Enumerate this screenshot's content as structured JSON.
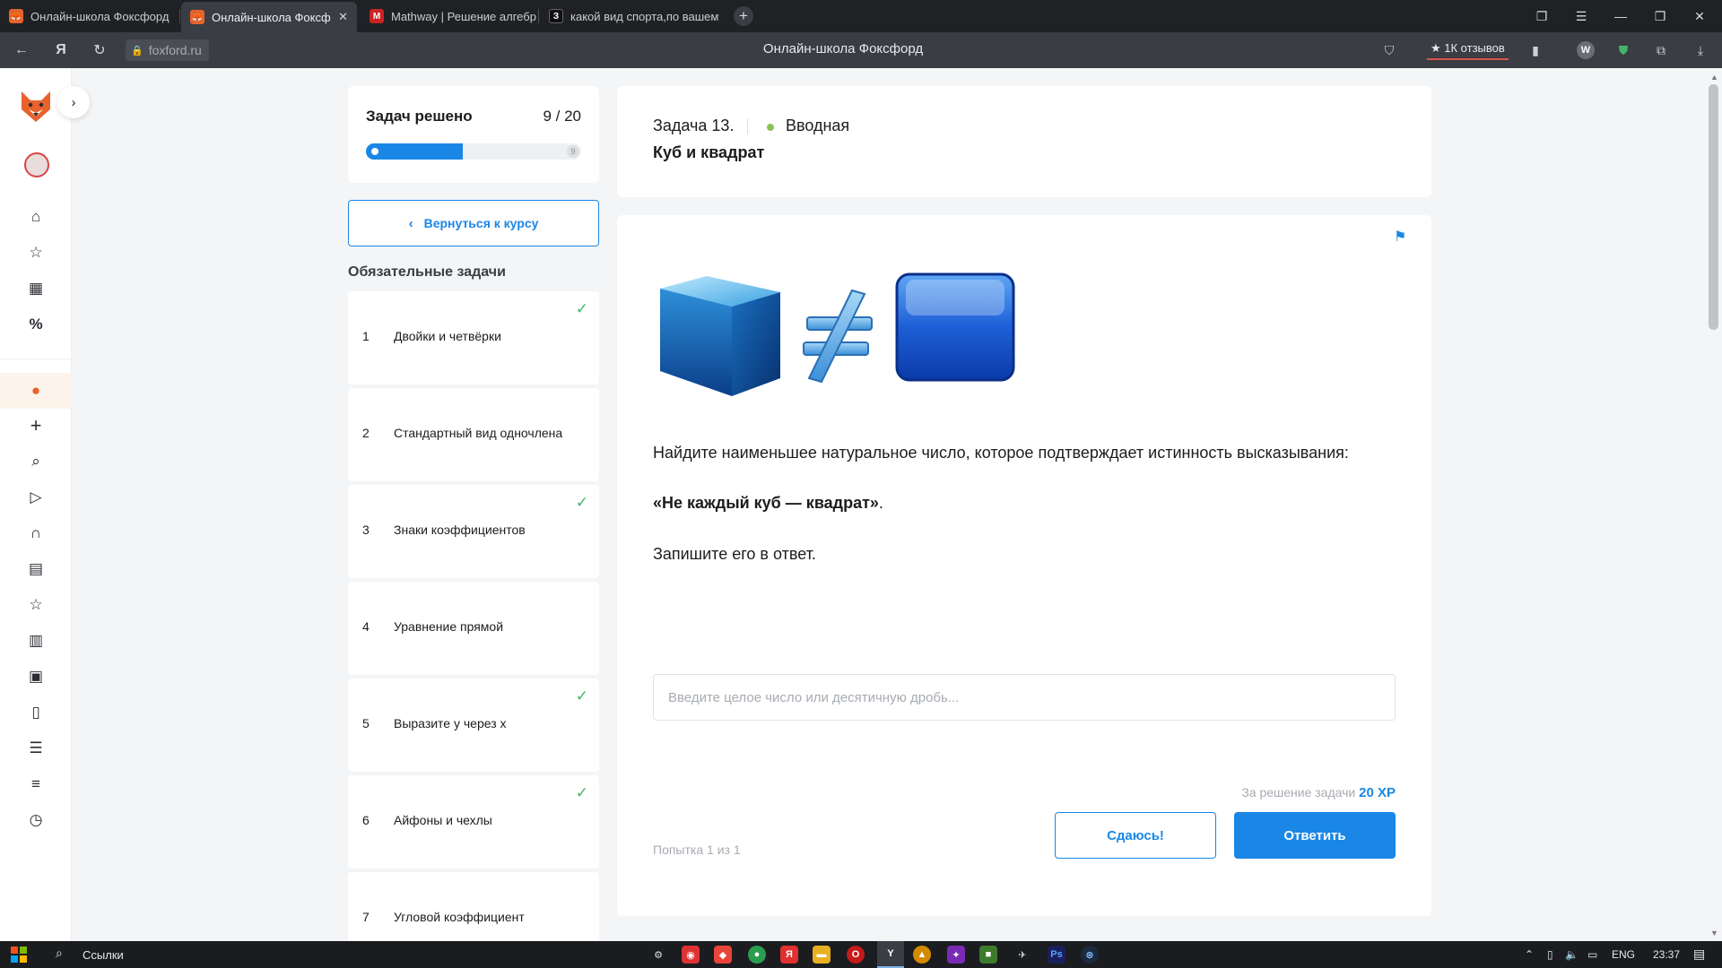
{
  "browser": {
    "tabs": [
      {
        "title": "Онлайн-школа Фоксфорд",
        "favicon": "fox-icon",
        "color": "#e8622c",
        "active": false
      },
      {
        "title": "Онлайн-школа Фоксфорд",
        "favicon": "fox-icon",
        "color": "#e8622c",
        "active": true
      },
      {
        "title": "Mathway | Решение алгебраических задач",
        "favicon": "mathway-icon",
        "color": "#c22",
        "active": false
      },
      {
        "title": "какой вид спорта,по вашему",
        "favicon": "znanija-icon",
        "color": "#111",
        "active": false
      }
    ],
    "url": "foxford.ru",
    "page_title": "Онлайн-школа Фоксфорд",
    "reviews": "★ 1К отзывов",
    "profile_letter": "W",
    "tab_letter_mathway": "M",
    "tab_letter_znanija": "З"
  },
  "sidebar": {
    "progress": {
      "title": "Задач решено",
      "count": "9 / 20",
      "solved": 9,
      "total": 20,
      "end_label": "9"
    },
    "back_button": "Вернуться к курсу",
    "section_title": "Обязательные задачи",
    "tasks": [
      {
        "num": "1",
        "name": "Двойки и четвёрки",
        "done": true
      },
      {
        "num": "2",
        "name": "Стандартный вид одночлена",
        "done": false
      },
      {
        "num": "3",
        "name": "Знаки коэффициентов",
        "done": true
      },
      {
        "num": "4",
        "name": "Уравнение прямой",
        "done": false
      },
      {
        "num": "5",
        "name": "Выразите y через x",
        "done": true
      },
      {
        "num": "6",
        "name": "Айфоны и чехлы",
        "done": true
      },
      {
        "num": "7",
        "name": "Угловой коэффициент",
        "done": false
      }
    ]
  },
  "task": {
    "number": "Задача 13.",
    "type": "Вводная",
    "name": "Куб и квадрат",
    "question_line1": "Найдите наименьшее натуральное число, которое подтверждает истинность высказывания:",
    "question_quote": "«Не каждый куб — квадрат»",
    "question_quote_tail": ".",
    "question_line3": "Запишите его в ответ.",
    "input_placeholder": "Введите целое число или десятичную дробь...",
    "reward_label": "За решение задачи",
    "reward_xp": "20 XP",
    "attempts": "Попытка 1 из 1",
    "giveup_button": "Сдаюсь!",
    "answer_button": "Ответить"
  },
  "taskbar": {
    "search_label": "Ссылки",
    "language": "ENG",
    "time": "23:37"
  },
  "colors": {
    "accent": "#1a87e6",
    "success": "#45b36b",
    "type_dot": "#8cc152"
  }
}
